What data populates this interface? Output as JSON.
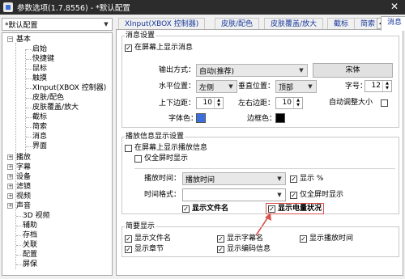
{
  "window": {
    "title": "参数选项(1.7.8556) - *默认配置",
    "close_glyph": "✕"
  },
  "profile": {
    "selected": "*默认配置"
  },
  "tree": {
    "groups": [
      {
        "label": "基本",
        "expanded": true,
        "children": [
          "启始",
          "快捷键",
          "鼠标",
          "触摸",
          "XInput(XBOX 控制器)",
          "皮肤/配色",
          "皮肤覆盖/放大",
          "截标",
          "简索",
          "消息",
          "界面"
        ]
      },
      {
        "label": "播放"
      },
      {
        "label": "字幕"
      },
      {
        "label": "设备"
      },
      {
        "label": "滤镜"
      },
      {
        "label": "视频"
      },
      {
        "label": "声音"
      },
      {
        "label": "3D 视频"
      },
      {
        "label": "辅助"
      },
      {
        "label": "存档"
      },
      {
        "label": "关联"
      },
      {
        "label": "配置"
      },
      {
        "label": "屏保"
      }
    ]
  },
  "tabs": [
    "XInput(XBOX 控制器)",
    "皮肤/配色",
    "皮肤覆盖/放大",
    "截标",
    "简索",
    "消息"
  ],
  "active_tab": "消息",
  "msg_settings": {
    "group_label": "消息设置",
    "show_on_screen": {
      "label": "在屏幕上显示消息",
      "checked": true
    },
    "output_method_label": "输出方式：",
    "output_method_value": "自动(推荐)",
    "font_button": "宋体",
    "hpos_label": "水平位置：",
    "hpos_value": "左侧",
    "vpos_label": "垂直位置：",
    "vpos_value": "顶部",
    "size_label": "字号：",
    "size_value": "12",
    "tb_margin_label": "上下边距：",
    "tb_margin_value": "10",
    "lr_margin_label": "左右边距：",
    "lr_margin_value": "10",
    "auto_size": {
      "label": "自动调整大小",
      "checked": false
    },
    "font_color_label": "字体色：",
    "font_color": "#3b6fe0",
    "border_color_label": "边框色：",
    "border_color": "#000000"
  },
  "playback_info": {
    "group_label": "播放信息显示设置",
    "show_on_screen": {
      "label": "在屏幕上显示播放信息",
      "checked": false
    },
    "fullscreen_only": {
      "label": "仅全屏时显示",
      "checked": false
    },
    "play_time_label": "播放时间：",
    "play_time_value": "播放时间",
    "show_percent": {
      "label": "显示 %",
      "checked": true
    },
    "time_format_label": "时间格式：",
    "time_format_value": "",
    "fullscreen_only_2": {
      "label": "仅全屏时显示",
      "checked": true
    },
    "show_filename": {
      "label": "显示文件名",
      "checked": true
    },
    "show_battery": {
      "label": "显示电量状况",
      "checked": true
    }
  },
  "brief": {
    "group_label": "简要显示",
    "items": [
      {
        "label": "显示文件名",
        "checked": true
      },
      {
        "label": "显示字幕名",
        "checked": true
      },
      {
        "label": "显示播放时间",
        "checked": true
      },
      {
        "label": "显示章节",
        "checked": true
      },
      {
        "label": "显示编码信息",
        "checked": true
      }
    ]
  },
  "colors": {
    "accent": "#d9534f",
    "tab_text": "#1a3a9c",
    "title_bar": "#2c2c2c"
  }
}
